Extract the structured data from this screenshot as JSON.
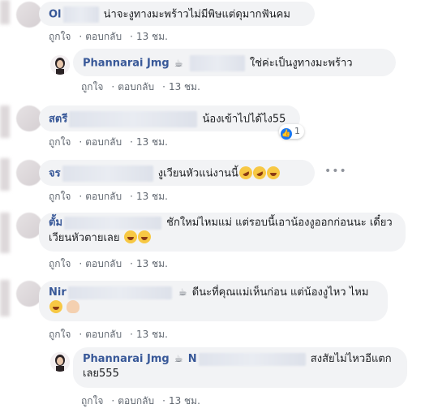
{
  "meta": {
    "like": "ถูกใจ",
    "reply": "ตอบกลับ",
    "sep": "·"
  },
  "comments": [
    {
      "name": "Ol",
      "text": "น่าจะงูทางมะพร้าวไม่มีพิษแต่ดุมากฟันคม",
      "time": "13 ชม."
    },
    {
      "name": "Phannarai Jmg",
      "text": "ใช่ค่ะเป็นงูทางมะพร้าว",
      "time": "13 ชม."
    },
    {
      "name": "สตรี",
      "text": "น้องเข้าไปได้ไง55",
      "time": "13 ชม.",
      "reaction_count": "1"
    },
    {
      "name": "จร",
      "text": "งูเวียนหัวแน่งานนี้",
      "time": "13 ชม."
    },
    {
      "name": "ตั้ม",
      "text": "ชักใหม่ไหมแม่ แต่รอบนี้เอาน้องงูออกก่อนนะ เดี๋ยวเวียนหัวตายเลย",
      "time": "13 ชม."
    },
    {
      "name": "Nir",
      "text": "ดีนะที่คุณแม่เห็นก่อน แต่น้องงูไหว ไหม",
      "time": "13 ชม."
    },
    {
      "name": "Phannarai Jmg",
      "mention_prefix": "N",
      "text": "สงสัยไม่ไหวอีแตกเลย555",
      "time": "13 ชม."
    }
  ],
  "icons": {
    "more": "more-dots-icon",
    "coffee": "coffee-icon",
    "like_reaction": "like-reaction-icon"
  },
  "colors": {
    "name": "#385898",
    "bubble": "#f2f3f5",
    "meta": "#606770",
    "like": "#1877f2"
  }
}
